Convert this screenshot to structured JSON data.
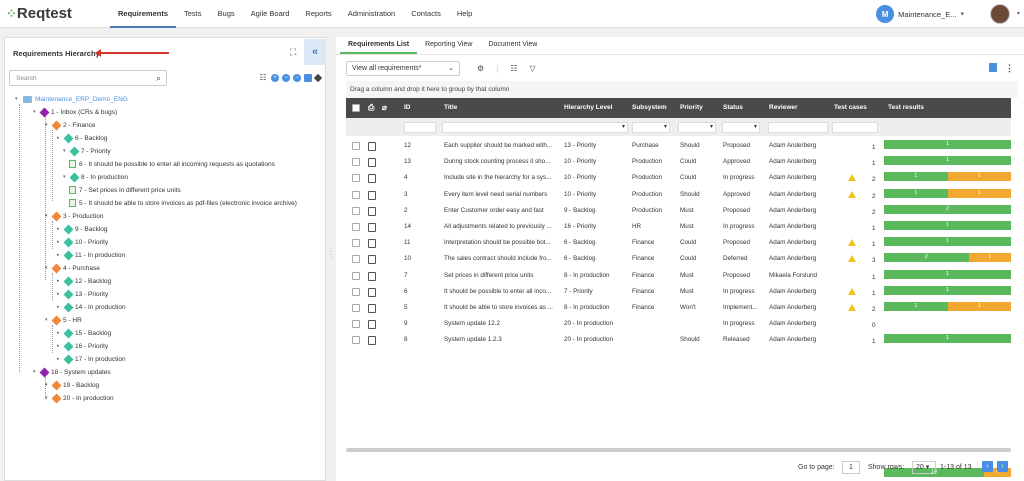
{
  "app": {
    "logo": "Reqtest"
  },
  "nav": [
    "Requirements",
    "Tests",
    "Bugs",
    "Agile Board",
    "Reports",
    "Administration",
    "Contacts",
    "Help"
  ],
  "user": {
    "initial": "M",
    "name": "Maintenance_E..."
  },
  "left": {
    "title": "Requirements Hierarchy",
    "search_placeholder": "Search",
    "tree": [
      {
        "label": "Maintenance_ERP_Demo_ENG",
        "type": "root"
      },
      {
        "label": "1 - Inbox (CRs & bugs)",
        "type": "purple"
      },
      {
        "label": "2 - Finance",
        "type": "orange"
      },
      {
        "label": "6 - Backlog",
        "type": "green"
      },
      {
        "label": "7 - Priority",
        "type": "green"
      },
      {
        "label": "6 - It should be possible to enter all incoming requests as quotations",
        "type": "doc"
      },
      {
        "label": "8 - In production",
        "type": "green"
      },
      {
        "label": "7 - Set prices in different price units",
        "type": "doc"
      },
      {
        "label": "5 - It should be able to store invoices as pdf-files (electronic invoice archive)",
        "type": "doc"
      },
      {
        "label": "3 - Production",
        "type": "orange"
      },
      {
        "label": "9 - Backlog",
        "type": "green"
      },
      {
        "label": "10 - Priority",
        "type": "green"
      },
      {
        "label": "11 - In production",
        "type": "green"
      },
      {
        "label": "4 - Purchase",
        "type": "orange"
      },
      {
        "label": "12 - Backlog",
        "type": "green"
      },
      {
        "label": "13 - Priority",
        "type": "green"
      },
      {
        "label": "14 - In production",
        "type": "green"
      },
      {
        "label": "5 - HR",
        "type": "orange"
      },
      {
        "label": "15 - Backlog",
        "type": "green"
      },
      {
        "label": "16 - Priority",
        "type": "green"
      },
      {
        "label": "17 - In production",
        "type": "green"
      },
      {
        "label": "18 - System updates",
        "type": "purple"
      },
      {
        "label": "19 - Backlog",
        "type": "orange"
      },
      {
        "label": "20 - In production",
        "type": "orange"
      }
    ]
  },
  "right": {
    "tabs": [
      "Requirements List",
      "Reporting View",
      "Document View"
    ],
    "view_select": "View all requirements*",
    "group_hint": "Drag a column and drop it here to group by that column",
    "columns": [
      "ID",
      "Title",
      "Hierarchy Level",
      "Subsystem",
      "Priority",
      "Status",
      "Reviewer",
      "Test cases",
      "Test results"
    ],
    "rows": [
      {
        "id": "12",
        "title": "Each supplier should be marked with...",
        "level": "13 - Priority",
        "sub": "Purchase",
        "prio": "Should",
        "status": "Proposed",
        "rev": "Adam Anderberg",
        "warn": false,
        "tc": "1",
        "bar": [
          1,
          0
        ]
      },
      {
        "id": "13",
        "title": "During stock counting process it sho...",
        "level": "10 - Priority",
        "sub": "Production",
        "prio": "Could",
        "status": "Approved",
        "rev": "Adam Anderberg",
        "warn": false,
        "tc": "1",
        "bar": [
          1,
          0
        ]
      },
      {
        "id": "4",
        "title": "Include site in the hierarchy for a sys...",
        "level": "10 - Priority",
        "sub": "Production",
        "prio": "Could",
        "status": "In progress",
        "rev": "Adam Anderberg",
        "warn": true,
        "tc": "2",
        "bar": [
          1,
          1
        ]
      },
      {
        "id": "3",
        "title": "Every item level need serial numbers",
        "level": "10 - Priority",
        "sub": "Production",
        "prio": "Should",
        "status": "Approved",
        "rev": "Adam Anderberg",
        "warn": true,
        "tc": "2",
        "bar": [
          1,
          1
        ]
      },
      {
        "id": "2",
        "title": "Enter Customer order easy and fast",
        "level": "9 - Backlog",
        "sub": "Production",
        "prio": "Must",
        "status": "Proposed",
        "rev": "Adam Anderberg",
        "warn": false,
        "tc": "2",
        "bar": [
          2,
          0
        ]
      },
      {
        "id": "14",
        "title": "All adjustments related to previously ...",
        "level": "16 - Priority",
        "sub": "HR",
        "prio": "Must",
        "status": "In progress",
        "rev": "Adam Anderberg",
        "warn": false,
        "tc": "1",
        "bar": [
          1,
          0
        ]
      },
      {
        "id": "11",
        "title": "Interpretation should be possible bot...",
        "level": "6 - Backlog",
        "sub": "Finance",
        "prio": "Could",
        "status": "Proposed",
        "rev": "Adam Anderberg",
        "warn": true,
        "tc": "1",
        "bar": [
          1,
          0
        ]
      },
      {
        "id": "10",
        "title": "The sales contract should include fro...",
        "level": "6 - Backlog",
        "sub": "Finance",
        "prio": "Could",
        "status": "Deferred",
        "rev": "Adam Anderberg",
        "warn": true,
        "tc": "3",
        "bar": [
          2,
          1
        ]
      },
      {
        "id": "7",
        "title": "Set prices in different price units",
        "level": "8 - In production",
        "sub": "Finance",
        "prio": "Must",
        "status": "Proposed",
        "rev": "Mikaela Forslund",
        "warn": false,
        "tc": "1",
        "bar": [
          1,
          0
        ]
      },
      {
        "id": "6",
        "title": "It should be possible to enter all inco...",
        "level": "7 - Priority",
        "sub": "Finance",
        "prio": "Must",
        "status": "In progress",
        "rev": "Adam Anderberg",
        "warn": true,
        "tc": "1",
        "bar": [
          1,
          0
        ]
      },
      {
        "id": "5",
        "title": "It should be able to store invoices as ...",
        "level": "8 - In production",
        "sub": "Finance",
        "prio": "Won't",
        "status": "Implement...",
        "rev": "Adam Anderberg",
        "warn": true,
        "tc": "2",
        "bar": [
          1,
          1
        ]
      },
      {
        "id": "9",
        "title": "System update 12.2",
        "level": "20 - In production",
        "sub": "",
        "prio": "",
        "status": "In progress",
        "rev": "Adam Anderberg",
        "warn": false,
        "tc": "0",
        "bar": [
          0,
          0
        ]
      },
      {
        "id": "8",
        "title": "System update 1.2.3",
        "level": "20 - In production",
        "sub": "",
        "prio": "Should",
        "status": "Released",
        "rev": "Adam Anderberg",
        "warn": false,
        "tc": "1",
        "bar": [
          1,
          0
        ]
      }
    ],
    "totals": {
      "green": "14",
      "orange": "4"
    },
    "footer": {
      "goto_label": "Go to page:",
      "page": "1",
      "show_label": "Show rows:",
      "rows": "20",
      "range": "1-13 of 13"
    }
  },
  "colors": {
    "green": "#5cb85c",
    "orange": "#f0a830",
    "accent": "#4a90e2"
  }
}
